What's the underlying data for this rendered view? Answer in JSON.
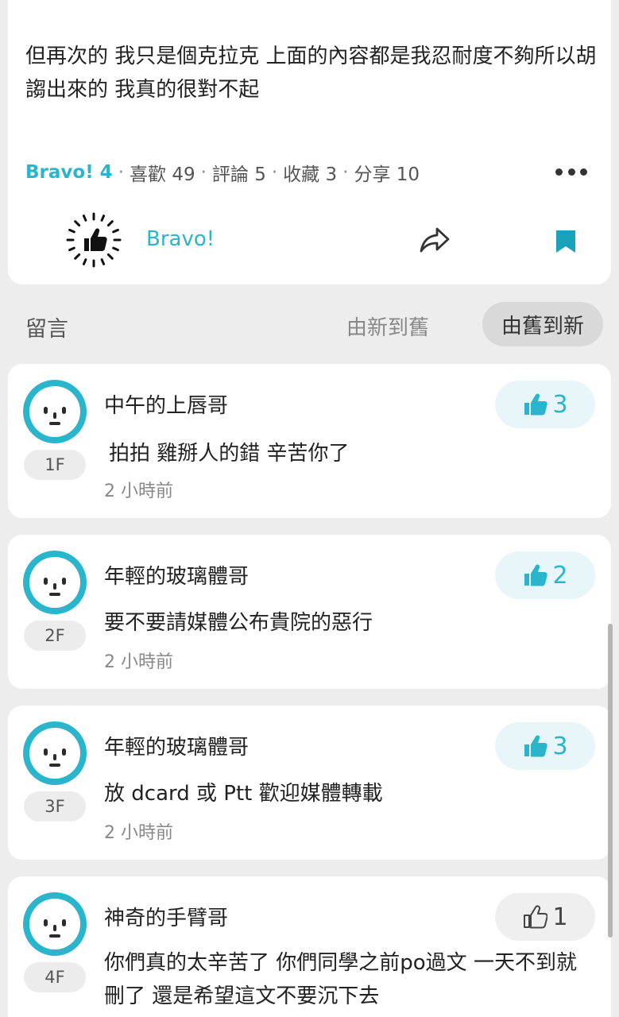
{
  "post": {
    "body": "但再次的 我只是個克拉克 上面的內容都是我忍耐度不夠所以胡謅出來的 我真的很對不起",
    "stats": {
      "bravo": "Bravo! 4",
      "likes": "喜歡 49",
      "comments": "評論 5",
      "saves": "收藏 3",
      "shares": "分享 10",
      "separator": "·"
    },
    "actions": {
      "bravo_label": "Bravo!"
    }
  },
  "comments_section": {
    "title": "留言",
    "sort_newest": "由新到舊",
    "sort_oldest": "由舊到新",
    "items": [
      {
        "floor": "1F",
        "author": "中午的上唇哥",
        "text": "拍拍 雞掰人的錯 辛苦你了",
        "time": "2 小時前",
        "likes": "3",
        "liked": true
      },
      {
        "floor": "2F",
        "author": "年輕的玻璃體哥",
        "text": "要不要請媒體公布貴院的惡行",
        "time": "2 小時前",
        "likes": "2",
        "liked": true
      },
      {
        "floor": "3F",
        "author": "年輕的玻璃體哥",
        "text": "放 dcard 或 Ptt 歡迎媒體轉載",
        "time": "2 小時前",
        "likes": "3",
        "liked": true
      },
      {
        "floor": "4F",
        "author": "神奇的手臂哥",
        "text": "你們真的太辛苦了 你們同學之前po過文 一天不到就刪了 還是希望這文不要沉下去",
        "time": "",
        "likes": "1",
        "liked": false
      }
    ]
  },
  "colors": {
    "accent": "#2ab5cc",
    "background": "#ededed",
    "card": "#ffffff"
  }
}
